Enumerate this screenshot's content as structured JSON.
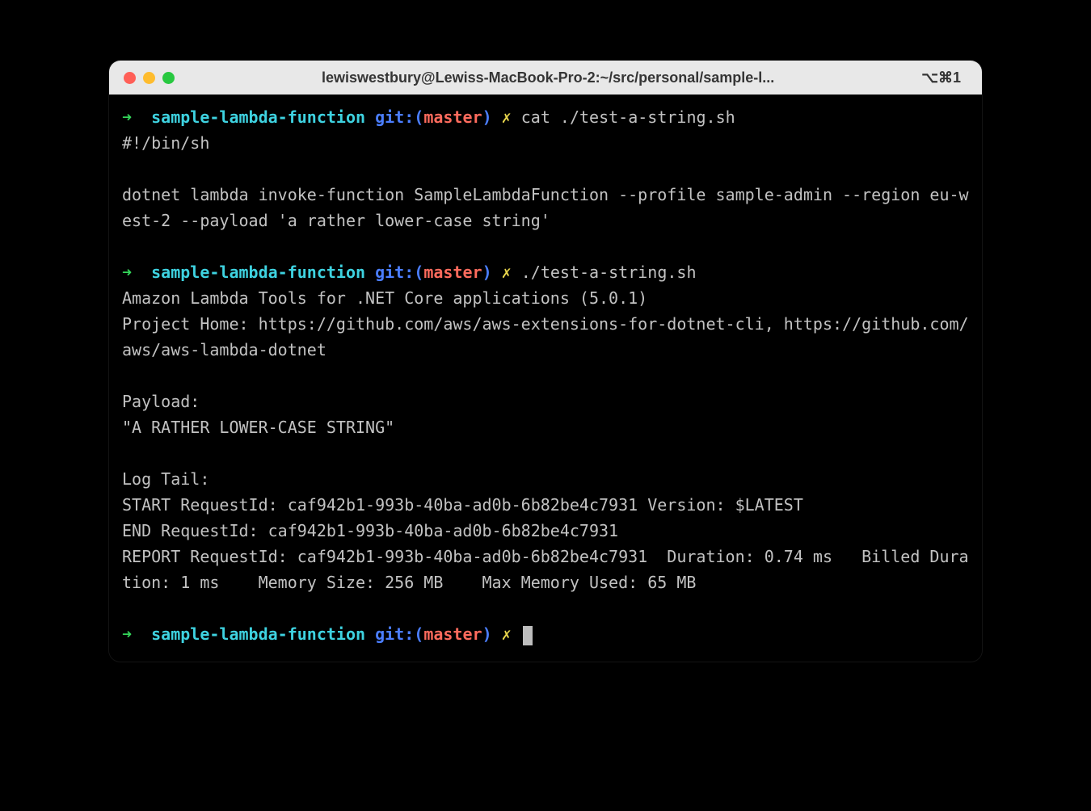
{
  "window": {
    "title": "lewiswestbury@Lewiss-MacBook-Pro-2:~/src/personal/sample-l...",
    "shortcut": "⌥⌘1"
  },
  "prompt": {
    "arrow": "➜",
    "cwd": "sample-lambda-function",
    "git_label": "git:",
    "git_paren_open": "(",
    "git_branch": "master",
    "git_paren_close": ")",
    "dirty": "✗"
  },
  "lines": {
    "cmd1": "cat ./test-a-string.sh",
    "out1a": "#!/bin/sh",
    "out1b": "",
    "out1c": "dotnet lambda invoke-function SampleLambdaFunction --profile sample-admin --region eu-west-2 --payload 'a rather lower-case string'",
    "out1d": "",
    "cmd2": "./test-a-string.sh",
    "out2a": "Amazon Lambda Tools for .NET Core applications (5.0.1)",
    "out2b": "Project Home: https://github.com/aws/aws-extensions-for-dotnet-cli, https://github.com/aws/aws-lambda-dotnet",
    "out2c": "",
    "out2d": "Payload:",
    "out2e": "\"A RATHER LOWER-CASE STRING\"",
    "out2f": "",
    "out2g": "Log Tail:",
    "out2h": "START RequestId: caf942b1-993b-40ba-ad0b-6b82be4c7931 Version: $LATEST",
    "out2i": "END RequestId: caf942b1-993b-40ba-ad0b-6b82be4c7931",
    "out2j": "REPORT RequestId: caf942b1-993b-40ba-ad0b-6b82be4c7931  Duration: 0.74 ms   Billed Duration: 1 ms    Memory Size: 256 MB    Max Memory Used: 65 MB",
    "out2k": ""
  }
}
